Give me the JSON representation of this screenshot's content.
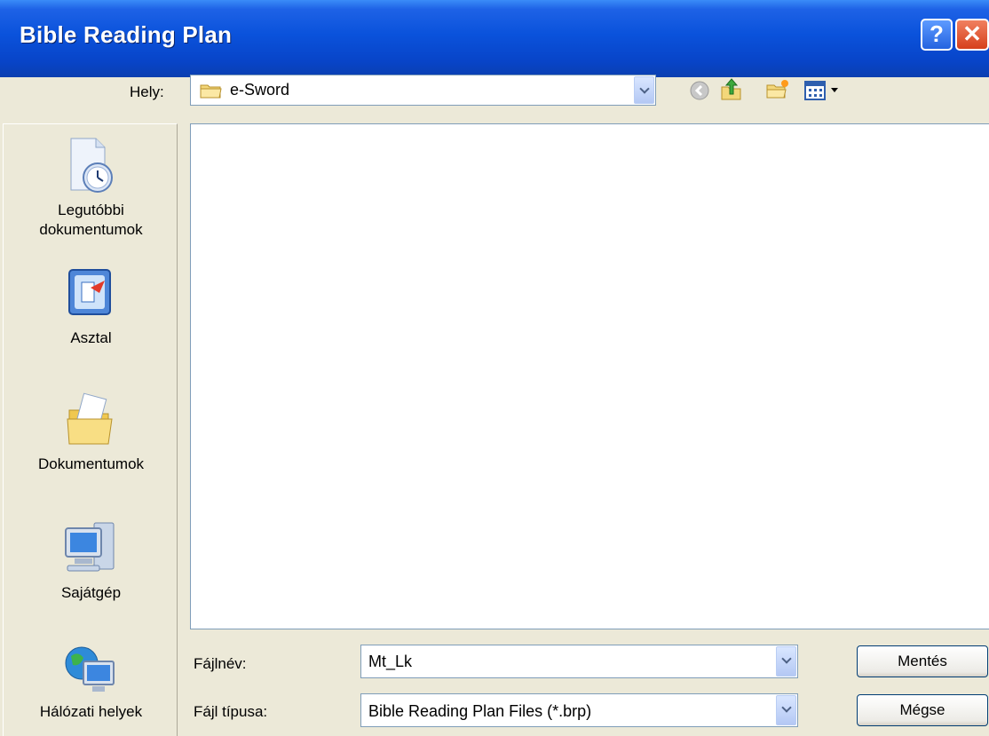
{
  "window": {
    "title": "Bible Reading Plan",
    "help_button": "?",
    "close_button": "✕"
  },
  "location": {
    "label": "Hely:",
    "value": "e-Sword"
  },
  "toolbar": {
    "icons": [
      "back-icon",
      "up-folder-icon",
      "new-folder-icon",
      "view-menu-icon"
    ]
  },
  "places": [
    {
      "label_line1": "Legutóbbi",
      "label_line2": "dokumentumok",
      "icon": "recent-documents-icon"
    },
    {
      "label_line1": "Asztal",
      "label_line2": "",
      "icon": "desktop-icon"
    },
    {
      "label_line1": "Dokumentumok",
      "label_line2": "",
      "icon": "my-documents-icon"
    },
    {
      "label_line1": "Sajátgép",
      "label_line2": "",
      "icon": "my-computer-icon"
    },
    {
      "label_line1": "Hálózati helyek",
      "label_line2": "",
      "icon": "network-places-icon"
    }
  ],
  "filename": {
    "label": "Fájlnév:",
    "value": "Mt_Lk"
  },
  "filetype": {
    "label": "Fájl típusa:",
    "value": "Bible Reading Plan Files (*.brp)"
  },
  "buttons": {
    "save": "Mentés",
    "cancel": "Mégse"
  }
}
